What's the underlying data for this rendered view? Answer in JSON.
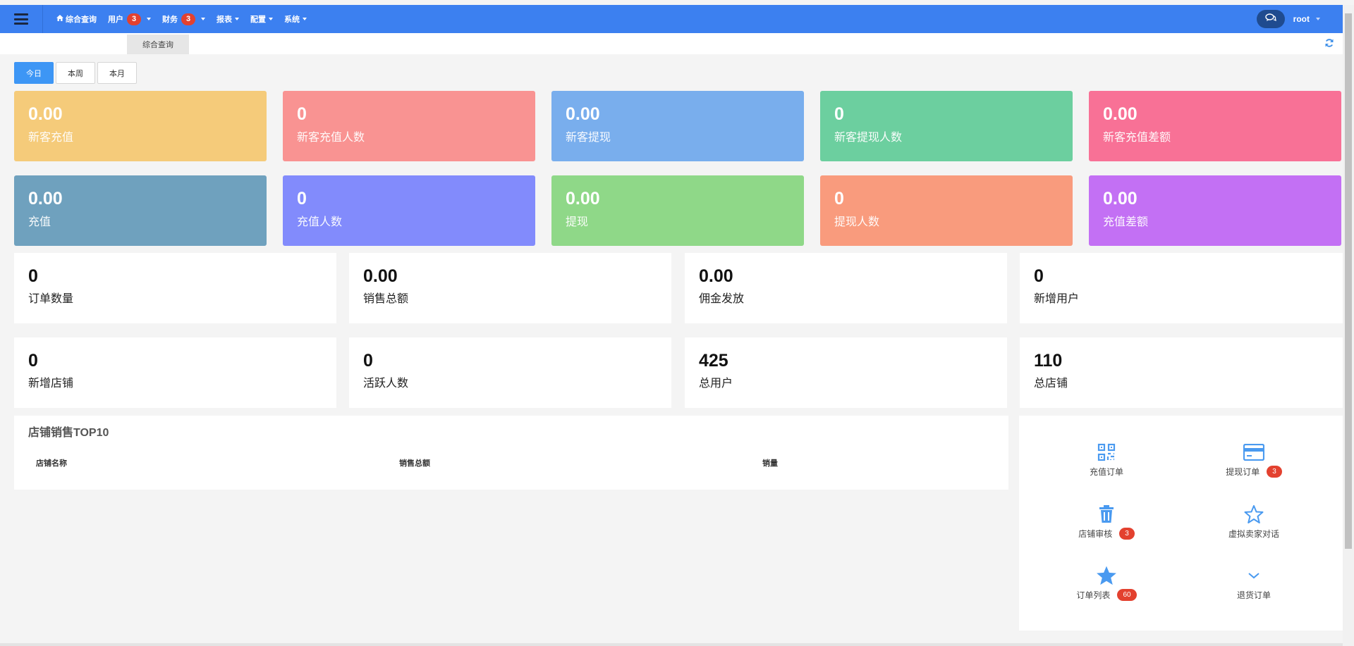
{
  "nav": {
    "items": [
      {
        "label": "综合查询",
        "badge": "",
        "caret": false,
        "home": true
      },
      {
        "label": "用户",
        "badge": "3",
        "caret": true,
        "home": false
      },
      {
        "label": "财务",
        "badge": "3",
        "caret": true,
        "home": false
      },
      {
        "label": "报表",
        "badge": "",
        "caret": true,
        "home": false
      },
      {
        "label": "配置",
        "badge": "",
        "caret": true,
        "home": false
      },
      {
        "label": "系统",
        "badge": "",
        "caret": true,
        "home": false
      }
    ],
    "user": "root"
  },
  "tabs": {
    "active": "综合查询"
  },
  "periods": {
    "today": "今日",
    "week": "本周",
    "month": "本月"
  },
  "cards_row1": [
    {
      "value": "0.00",
      "label": "新客充值",
      "color": "#f5cb7a"
    },
    {
      "value": "0",
      "label": "新客充值人数",
      "color": "#f99392"
    },
    {
      "value": "0.00",
      "label": "新客提现",
      "color": "#79aeed"
    },
    {
      "value": "0",
      "label": "新客提现人数",
      "color": "#6ccf9f"
    },
    {
      "value": "0.00",
      "label": "新客充值差额",
      "color": "#f87196"
    }
  ],
  "cards_row2": [
    {
      "value": "0.00",
      "label": "充值",
      "color": "#6fa1be"
    },
    {
      "value": "0",
      "label": "充值人数",
      "color": "#828bfc"
    },
    {
      "value": "0.00",
      "label": "提现",
      "color": "#8fd888"
    },
    {
      "value": "0",
      "label": "提现人数",
      "color": "#f99b7d"
    },
    {
      "value": "0.00",
      "label": "充值差额",
      "color": "#c370f4"
    }
  ],
  "stats_row1": [
    {
      "value": "0",
      "label": "订单数量"
    },
    {
      "value": "0.00",
      "label": "销售总额"
    },
    {
      "value": "0.00",
      "label": "佣金发放"
    },
    {
      "value": "0",
      "label": "新增用户"
    }
  ],
  "stats_row2": [
    {
      "value": "0",
      "label": "新增店铺"
    },
    {
      "value": "0",
      "label": "活跃人数"
    },
    {
      "value": "425",
      "label": "总用户"
    },
    {
      "value": "110",
      "label": "总店铺"
    }
  ],
  "top10": {
    "title": "店铺销售TOP10",
    "columns": [
      "店铺名称",
      "销售总额",
      "销量"
    ]
  },
  "shortcuts": [
    {
      "label": "充值订单",
      "badge": "",
      "icon": "qrcode-icon"
    },
    {
      "label": "提现订单",
      "badge": "3",
      "icon": "credit-card-icon"
    },
    {
      "label": "店铺审核",
      "badge": "3",
      "icon": "trash-icon"
    },
    {
      "label": "虚拟卖家对话",
      "badge": "",
      "icon": "star-outline-icon"
    },
    {
      "label": "订单列表",
      "badge": "60",
      "icon": "star-filled-icon"
    },
    {
      "label": "退货订单",
      "badge": "",
      "icon": "chevron-down-icon"
    }
  ],
  "colors": {
    "navbar": "#3c80f0",
    "accent": "#3d96f5",
    "badge": "#e3412f",
    "icon": "#4a9af0"
  }
}
